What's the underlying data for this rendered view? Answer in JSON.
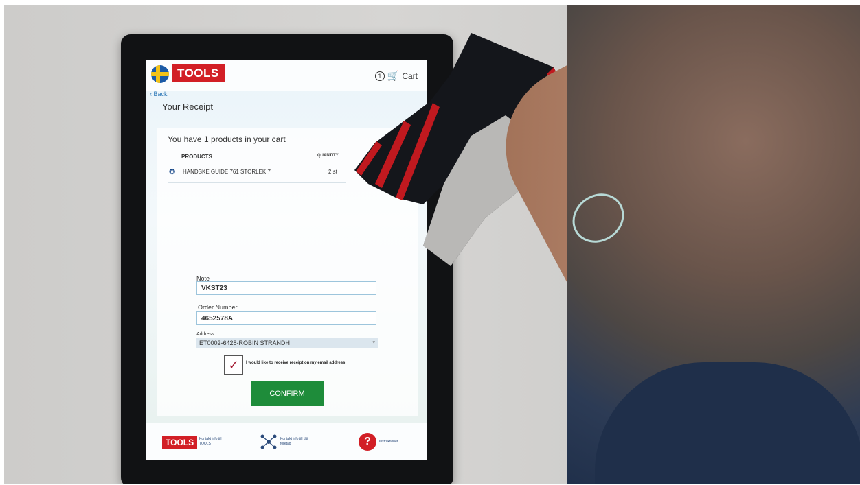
{
  "kiosk": {
    "logo_text": "TOOLS",
    "cart": {
      "count": "1",
      "label": "Cart"
    },
    "nav": {
      "back_label": "Back"
    },
    "page_title": "Your Receipt",
    "cart_summary": "You have 1 products in your cart",
    "table": {
      "headers": {
        "products": "PRODUCTS",
        "quantity": "QUANTITY"
      },
      "rows": [
        {
          "product": "HANDSKE GUIDE 761 STORLEK 7",
          "quantity": "2 st"
        }
      ]
    },
    "form": {
      "note": {
        "label": "Note",
        "value": "VKST23"
      },
      "order_number": {
        "label": "Order Number",
        "value": "4652578A"
      },
      "address": {
        "label": "Address",
        "value": "ET0002-6428-ROBIN STRANDH"
      },
      "email_receipt": {
        "label": "I would like to receive receipt on my email address",
        "checked": true
      },
      "confirm_label": "CONFIRM"
    },
    "footer": {
      "contact_tools": "Kontakt info till TOOLS",
      "contact_company": "Kontakt info till ditt företag",
      "instructions": "Instruktioner",
      "help_glyph": "?"
    }
  },
  "colors": {
    "brand_red": "#d21f26",
    "confirm_green": "#1e8c3a",
    "link_blue": "#2a76b6"
  },
  "icons": [
    "sweden-flag-icon",
    "cart-icon",
    "glove-product-icon",
    "network-icon",
    "help-icon"
  ]
}
